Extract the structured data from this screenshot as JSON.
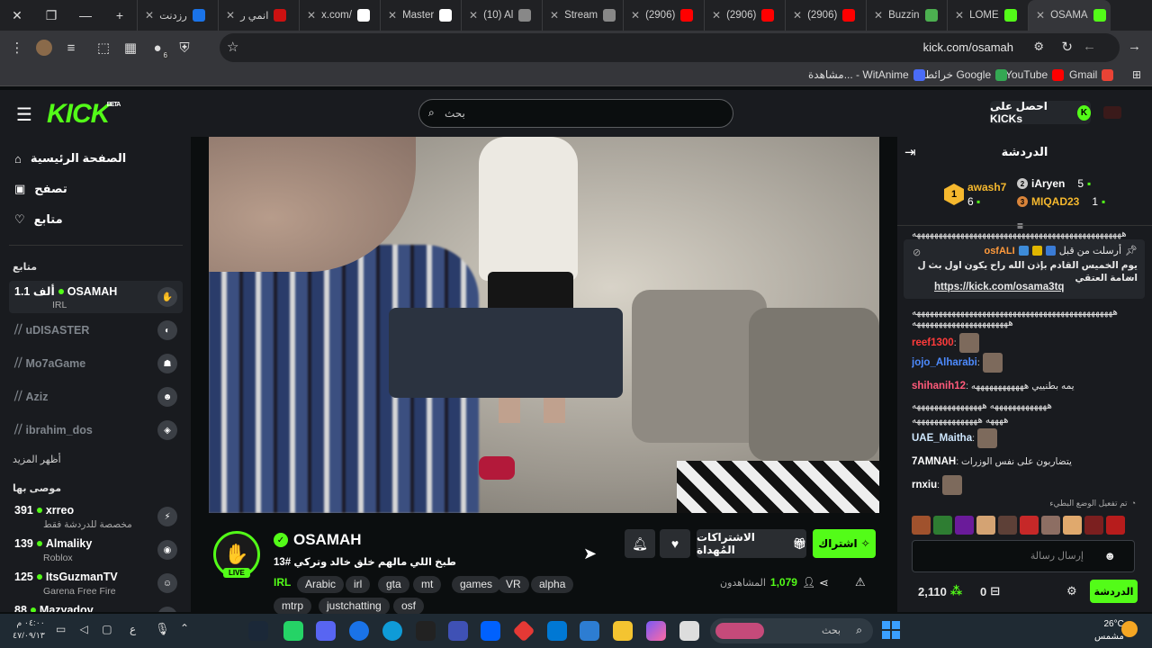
{
  "browser": {
    "tabs": [
      {
        "title": "رزدنت",
        "color": "#1a73e8"
      },
      {
        "title": "انمي ر",
        "color": "#c11"
      },
      {
        "title": "x.com/",
        "color": "#fff"
      },
      {
        "title": "Master",
        "color": "#fff"
      },
      {
        "title": "(10) Al",
        "color": "#888"
      },
      {
        "title": "Stream",
        "color": "#888"
      },
      {
        "title": "(2906)",
        "color": "#f00"
      },
      {
        "title": "(2906)",
        "color": "#f00"
      },
      {
        "title": "(2906)",
        "color": "#f00"
      },
      {
        "title": "Buzzin",
        "color": "#4caf50"
      },
      {
        "title": "LOME",
        "color": "#53fc18"
      },
      {
        "title": "OSAMA",
        "color": "#53fc18"
      }
    ],
    "url": "kick.com/osamah",
    "extension_badge": "6",
    "bookmarks": [
      {
        "label": "Gmail",
        "color": "#ea4335"
      },
      {
        "label": "YouTube",
        "color": "#f00"
      },
      {
        "label": "خرائط Google",
        "color": "#34a853"
      },
      {
        "label": "مشاهدة... - WitAnime",
        "color": "#4a6cf7"
      }
    ]
  },
  "header": {
    "logo": "KICK",
    "logo_beta": "BETA",
    "search_placeholder": "بحث",
    "get_kicks": "احصل على KICKs",
    "kicks_icon": "K"
  },
  "sidebar": {
    "nav": [
      {
        "label": "الصفحة الرئيسية",
        "icon": "home-icon",
        "glyph": "⌂"
      },
      {
        "label": "تصفح",
        "icon": "browse-icon",
        "glyph": "▣"
      },
      {
        "label": "متابع",
        "icon": "heart-icon",
        "glyph": "♡"
      }
    ],
    "following_title": "متابع",
    "following": [
      {
        "name": "OSAMAH",
        "viewers": "1.1 ألف",
        "category": "IRL",
        "live": true,
        "avatar": "✋"
      },
      {
        "name": "uDISASTER",
        "live": false,
        "avatar": "◐"
      },
      {
        "name": "Mo7aGame",
        "live": false,
        "avatar": "☗"
      },
      {
        "name": "Aziz",
        "live": false,
        "avatar": "☻"
      },
      {
        "name": "ibrahim_dos",
        "live": false,
        "avatar": "◈"
      }
    ],
    "show_more": "أظهر المزيد",
    "recommended_title": "موصى بها",
    "recommended": [
      {
        "name": "xrreo",
        "viewers": "391",
        "category": "مخصصة للدردشة فقط",
        "avatar": "⚡"
      },
      {
        "name": "Almaliky",
        "viewers": "139",
        "category": "Roblox",
        "avatar": "◉"
      },
      {
        "name": "ItsGuzmanTV",
        "viewers": "125",
        "category": "Garena Free Fire",
        "avatar": "☺"
      },
      {
        "name": "Mazyadov",
        "viewers": "88",
        "category": "",
        "avatar": "●"
      }
    ]
  },
  "channel": {
    "name": "OSAMAH",
    "live_label": "LIVE",
    "title": "طبخ اللي مالهم خلق خالد وتركي #13",
    "category": "IRL",
    "tags": [
      "Arabic",
      "irl",
      "gta",
      "mt",
      "games",
      "VR",
      "alpha",
      "mtrp",
      "justchatting",
      "osf"
    ],
    "subscribe": "اشتراك",
    "gift_subs": "الاشتراكات المُهداة",
    "viewers_label": "المشاهدون",
    "viewers_count": "1,079"
  },
  "chat": {
    "title": "الدردشة",
    "leaderboard": [
      {
        "rank": "1",
        "name": "awash7",
        "count": "6"
      },
      {
        "rank": "2",
        "name": "iAryen",
        "count": "5"
      },
      {
        "rank": "3",
        "name": "MIQAD23",
        "count": "1"
      }
    ],
    "pinned": {
      "by_label": "أرسلت من قبل",
      "user": "osfALI",
      "text": "يوم الخميس القادم بإذن الله راح يكون اول بث ل اسامة العتقي",
      "link": "https://kick.com/osama3tq"
    },
    "messages": [
      {
        "user": "",
        "color": "#fff",
        "text": "ههههههههههههههههههههههههههههههههههههههههههههههههه"
      },
      {
        "user": "",
        "color": "#fff",
        "text": "ههههههههههههههههههههههههههههههههههههههههههههههه"
      },
      {
        "user": "",
        "color": "#fff",
        "text": "ههههههههههههههههههههههه"
      },
      {
        "user": "reef1300",
        "color": "#ff3b3b",
        "text": ""
      },
      {
        "user": "jojo_Alharabi",
        "color": "#4d8bff",
        "text": ""
      },
      {
        "user": "shihanih12",
        "color": "#ff5a7a",
        "text": "يمه بطنييي ههههههههههههه"
      },
      {
        "user": "",
        "color": "#fff",
        "text": "هههههههههههههه ههههههههههههههههه"
      },
      {
        "user": "",
        "color": "#fff",
        "text": "ههههه هههههههههههههههه"
      },
      {
        "user": "UAE_Maitha",
        "color": "#cfe8ff",
        "text": ""
      },
      {
        "user": "7AMNAH",
        "color": "#fff",
        "text": "يتضاربون على نفس الوزرات"
      },
      {
        "user": "rnxiu",
        "color": "#fff",
        "text": ""
      }
    ],
    "slow_mode": "تم تفعيل الوضع البطيء",
    "input_placeholder": "إرسال رسالة",
    "kicks_balance": "2,110",
    "gifts_count": "0",
    "chat_button": "الدردشة"
  },
  "taskbar": {
    "search_placeholder": "بحث",
    "weather_temp": "26°C",
    "weather_desc": "مشمس",
    "time": "٠٤:٠٠ م",
    "date": "٤٧/٠٩/١٣",
    "lang": "ع"
  }
}
